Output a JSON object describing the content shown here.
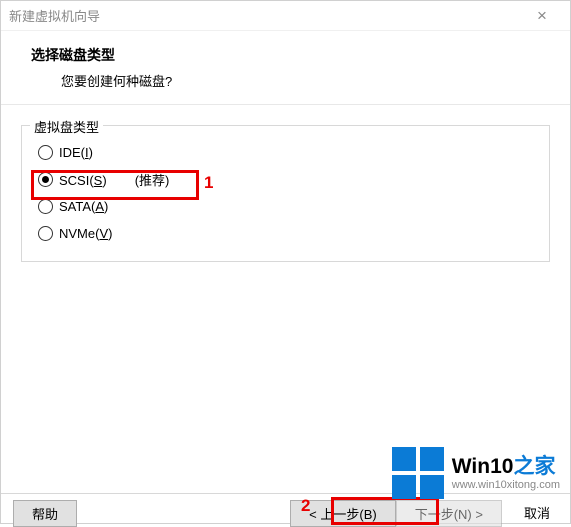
{
  "window": {
    "title": "新建虚拟机向导"
  },
  "header": {
    "title": "选择磁盘类型",
    "subtitle": "您要创建何种磁盘?"
  },
  "group": {
    "legend": "虚拟盘类型"
  },
  "options": {
    "ide": {
      "label": "IDE(",
      "mnemonic": "I",
      "suffix": ")"
    },
    "scsi": {
      "label": "SCSI(",
      "mnemonic": "S",
      "suffix": ")",
      "recommend": "(推荐)"
    },
    "sata": {
      "label": "SATA(",
      "mnemonic": "A",
      "suffix": ")"
    },
    "nvme": {
      "label": "NVMe(",
      "mnemonic": "V",
      "suffix": ")"
    }
  },
  "annotations": {
    "one": "1",
    "two": "2"
  },
  "buttons": {
    "help": "帮助",
    "back": "< 上一步(B)",
    "next": "下一步(N) >",
    "cancel": "取消"
  },
  "watermark": {
    "brand_main": "Win10",
    "brand_accent": "之家",
    "url": "www.win10xitong.com"
  }
}
